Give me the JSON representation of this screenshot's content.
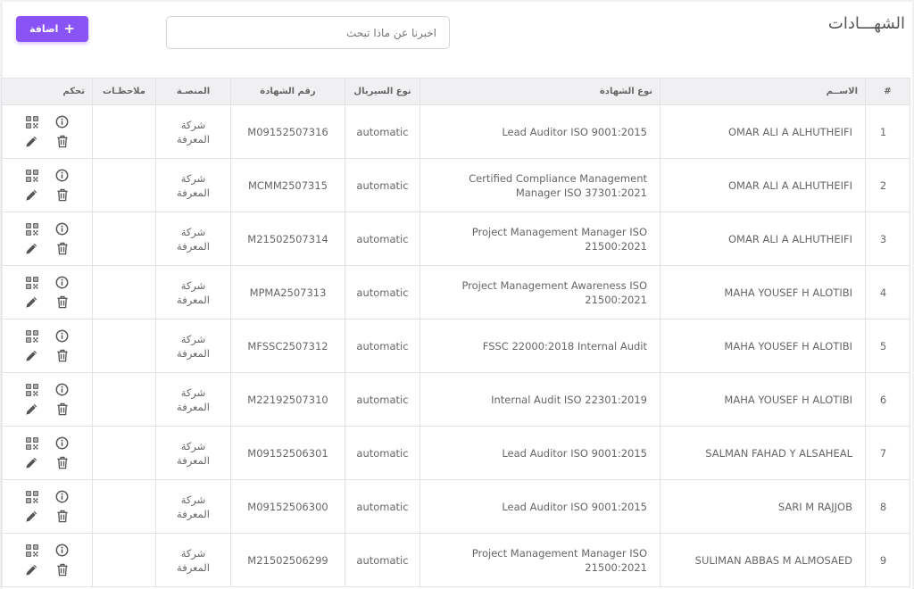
{
  "header": {
    "title": "الشهـــادات",
    "search_placeholder": "اخبرنا عن ماذا تبحث",
    "add_label": "اضافة"
  },
  "table": {
    "columns": {
      "num": "#",
      "name": "الاســم",
      "cert_type": "نوع الشهادة",
      "serial_type": "نوع السيريال",
      "cert_number": "رقم الشهادة",
      "platform": "المنصـة",
      "notes": "ملاحظـات",
      "control": "تحكم"
    },
    "rows": [
      {
        "num": "1",
        "name": "OMAR ALI A ALHUTHEIFI",
        "cert_type": "Lead Auditor ISO 9001:2015",
        "serial_type": "automatic",
        "cert_number": "M09152507316",
        "platform": "شركة المعرفة",
        "notes": ""
      },
      {
        "num": "2",
        "name": "OMAR ALI A ALHUTHEIFI",
        "cert_type": "Certified Compliance Management Manager ISO 37301:2021",
        "serial_type": "automatic",
        "cert_number": "MCMM2507315",
        "platform": "شركة المعرفة",
        "notes": ""
      },
      {
        "num": "3",
        "name": "OMAR ALI A ALHUTHEIFI",
        "cert_type": "Project Management Manager ISO 21500:2021",
        "serial_type": "automatic",
        "cert_number": "M21502507314",
        "platform": "شركة المعرفة",
        "notes": ""
      },
      {
        "num": "4",
        "name": "MAHA YOUSEF H ALOTIBI",
        "cert_type": "Project Management Awareness ISO 21500:2021",
        "serial_type": "automatic",
        "cert_number": "MPMA2507313",
        "platform": "شركة المعرفة",
        "notes": ""
      },
      {
        "num": "5",
        "name": "MAHA YOUSEF H ALOTIBI",
        "cert_type": "FSSC 22000:2018 Internal Audit",
        "serial_type": "automatic",
        "cert_number": "MFSSC2507312",
        "platform": "شركة المعرفة",
        "notes": ""
      },
      {
        "num": "6",
        "name": "MAHA YOUSEF H ALOTIBI",
        "cert_type": "Internal Audit ISO 22301:2019",
        "serial_type": "automatic",
        "cert_number": "M22192507310",
        "platform": "شركة المعرفة",
        "notes": ""
      },
      {
        "num": "7",
        "name": "SALMAN FAHAD Y ALSAHEAL",
        "cert_type": "Lead Auditor ISO 9001:2015",
        "serial_type": "automatic",
        "cert_number": "M09152506301",
        "platform": "شركة المعرفة",
        "notes": ""
      },
      {
        "num": "8",
        "name": "SARI M RAJJOB",
        "cert_type": "Lead Auditor ISO 9001:2015",
        "serial_type": "automatic",
        "cert_number": "M09152506300",
        "platform": "شركة المعرفة",
        "notes": ""
      },
      {
        "num": "9",
        "name": "SULIMAN ABBAS M ALMOSAED",
        "cert_type": "Project Management Manager ISO 21500:2021",
        "serial_type": "automatic",
        "cert_number": "M21502506299",
        "platform": "شركة المعرفة",
        "notes": ""
      }
    ]
  },
  "icons": {
    "qr": "qr-code-icon",
    "info": "info-icon",
    "edit": "pencil-icon",
    "delete": "trash-icon"
  }
}
